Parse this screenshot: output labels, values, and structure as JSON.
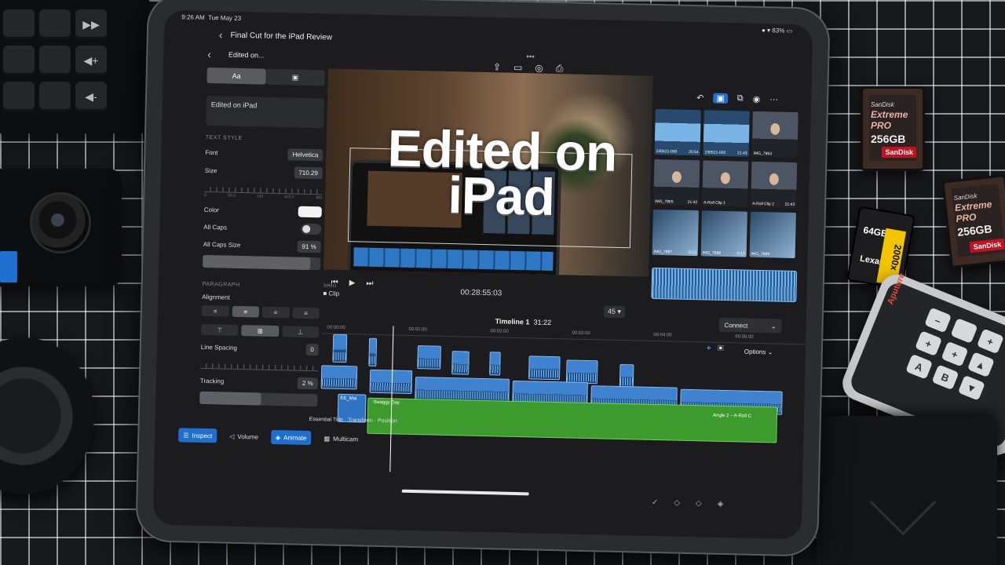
{
  "status": {
    "time": "9:26 AM",
    "date": "Tue May 23",
    "battery": "83%"
  },
  "project": {
    "title": "Final Cut for the iPad Review",
    "clip_name": "Edited on..."
  },
  "inspector": {
    "tab_text": "Aa",
    "tab_shape": "▣",
    "text_preview": "Edited on iPad",
    "section_text_style": "TEXT STYLE",
    "font_label": "Font",
    "font_value": "Helvetica",
    "size_label": "Size",
    "size_value": "710.29",
    "ruler_labels": [
      "0",
      "50.5",
      "150",
      "470.5",
      "300"
    ],
    "color_label": "Color",
    "all_caps_label": "All Caps",
    "all_caps_size_label": "All Caps Size",
    "all_caps_size_value": "91",
    "pct": "%",
    "section_paragraph": "PARAGRAPH",
    "alignment_label": "Alignment",
    "line_spacing_label": "Line Spacing",
    "line_spacing_value": "0",
    "tracking_label": "Tracking",
    "tracking_value": "2"
  },
  "viewer": {
    "title_line1": "Edited on",
    "title_line2": "iPad",
    "select_label": "Select",
    "clip_label": "Clip",
    "timecode": "00:28:55:03",
    "zoom": "45"
  },
  "browser": {
    "clips": [
      {
        "name": "230521-000",
        "dur": "25:54",
        "kind": "audio"
      },
      {
        "name": "230521-002",
        "dur": "21:43",
        "kind": "audio"
      },
      {
        "name": "IMG_7863",
        "dur": "",
        "kind": "person"
      },
      {
        "name": "IMG_7865",
        "dur": "21:42",
        "kind": "person"
      },
      {
        "name": "A-Roll Clip 1",
        "dur": "",
        "kind": "person"
      },
      {
        "name": "A-Roll Clip 2",
        "dur": "21:43",
        "kind": "person"
      },
      {
        "name": "IMG_7887",
        "dur": "0:13",
        "kind": "screen"
      },
      {
        "name": "IMG_7888",
        "dur": "0:17",
        "kind": "screen"
      },
      {
        "name": "IMG_7889",
        "dur": "",
        "kind": "screen"
      }
    ]
  },
  "timeline": {
    "name": "Timeline 1",
    "duration": "31:22",
    "connect_label": "Connect",
    "options_label": "Options",
    "ruler": [
      "00:00:00",
      "00:01:00",
      "00:02:00",
      "00:03:00",
      "00:04:00",
      "00:05:00"
    ],
    "title_clip": "EE_Mai",
    "music_clip": "Swaggy Day",
    "angle_clip": "Angle 2 – A-Roll C",
    "transform_label": "Essential Title · Transform · Position"
  },
  "bottom_bar": {
    "inspect": "Inspect",
    "volume": "Volume",
    "animate": "Animate",
    "multicam": "Multicam"
  },
  "props": {
    "card1_brand": "SanDisk",
    "card1_line": "Extreme PRO",
    "card1_cap": "256GB",
    "card2_cap": "64GB",
    "card2_brand": "Lexar",
    "card2_speed": "2000x",
    "remote_brand": "Aputure"
  }
}
